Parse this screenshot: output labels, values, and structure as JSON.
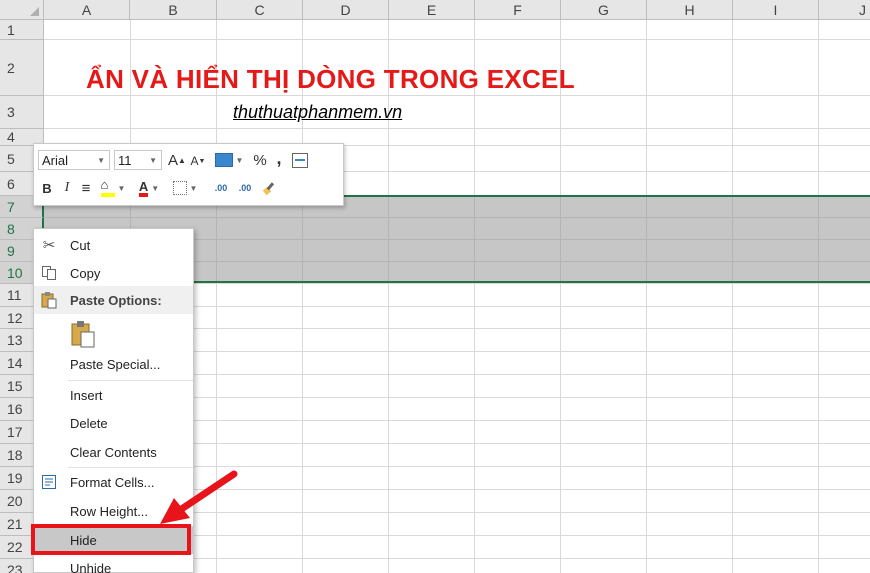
{
  "columns": [
    "A",
    "B",
    "C",
    "D",
    "E",
    "F",
    "G",
    "H",
    "I",
    "J"
  ],
  "rows": [
    "1",
    "2",
    "3",
    "4",
    "5",
    "6",
    "7",
    "8",
    "9",
    "10",
    "11",
    "12",
    "13",
    "14",
    "15",
    "16",
    "17",
    "18",
    "19",
    "20",
    "21",
    "22",
    "23"
  ],
  "title": "ẨN VÀ HIỂN THỊ DÒNG TRONG EXCEL",
  "subtitle": "thuthuatphanmem.vn",
  "mini_toolbar": {
    "font_name": "Arial",
    "font_size": "11",
    "percent": "%",
    "comma": ",",
    "bold": "B",
    "italic": "I",
    "dec_increase": ".00",
    "dec_decrease": ".00"
  },
  "context_menu": {
    "cut": "Cut",
    "copy": "Copy",
    "paste_options": "Paste Options:",
    "paste_special": "Paste Special...",
    "insert": "Insert",
    "delete": "Delete",
    "clear_contents": "Clear Contents",
    "format_cells": "Format Cells...",
    "row_height": "Row Height...",
    "hide": "Hide",
    "unhide": "Unhide"
  },
  "colors": {
    "accent_green": "#217346",
    "title_red": "#e61919",
    "highlight_red": "#e8141c",
    "selection_gray": "#c6c6c6"
  }
}
